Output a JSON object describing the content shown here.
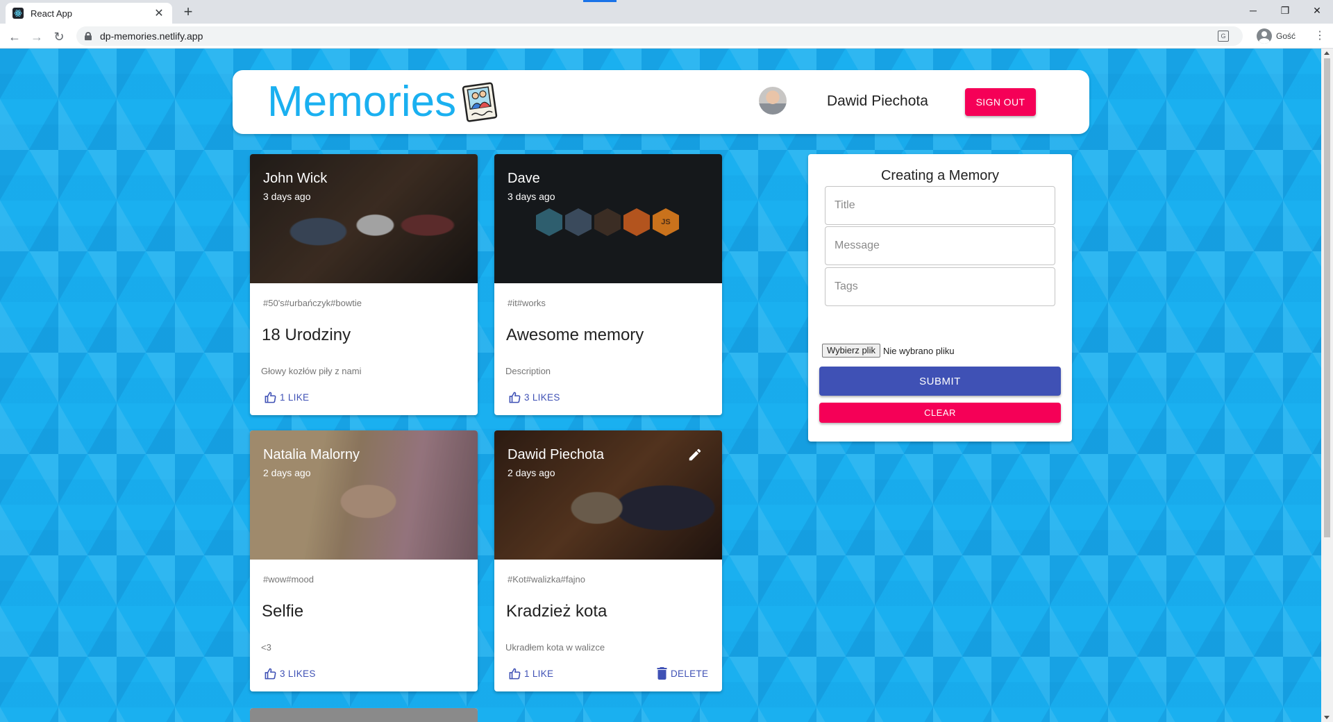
{
  "browser": {
    "tab_title": "React App",
    "url": "dp-memories.netlify.app",
    "profile_name": "Gość"
  },
  "header": {
    "brand": "Memories",
    "user_name": "Dawid Piechota",
    "signout_label": "SIGN OUT"
  },
  "posts": [
    {
      "author": "John Wick",
      "time": "3 days ago",
      "tags": "#50's#urbańczyk#bowtie",
      "title": "18 Urodziny",
      "message": "Głowy kozłów piły z nami",
      "likes": "1 LIKE"
    },
    {
      "author": "Dave",
      "time": "3 days ago",
      "tags": "#it#works",
      "title": "Awesome memory",
      "message": "Description",
      "likes": "3 LIKES"
    },
    {
      "author": "Natalia Malorny",
      "time": "2 days ago",
      "tags": "#wow#mood",
      "title": "Selfie",
      "message": "<3",
      "likes": "3 LIKES"
    },
    {
      "author": "Dawid Piechota",
      "time": "2 days ago",
      "tags": "#Kot#walizka#fajno",
      "title": "Kradzież kota",
      "message": "Ukradłem kota w walizce",
      "likes": "1 LIKE",
      "delete": "DELETE"
    }
  ],
  "form": {
    "title": "Creating a Memory",
    "title_placeholder": "Title",
    "message_placeholder": "Message",
    "tags_placeholder": "Tags",
    "file_button": "Wybierz plik",
    "file_status": "Nie wybrano pliku",
    "submit_label": "SUBMIT",
    "clear_label": "CLEAR"
  },
  "colors": {
    "background": "#1ab0f0",
    "brand": "#1ab0f0",
    "primary": "#3f51b5",
    "secondary": "#f50057"
  },
  "icons": [
    "react-icon",
    "lock-icon",
    "translate-icon",
    "memories-photo-icon",
    "thumb-up-icon",
    "delete-icon",
    "edit-icon"
  ]
}
